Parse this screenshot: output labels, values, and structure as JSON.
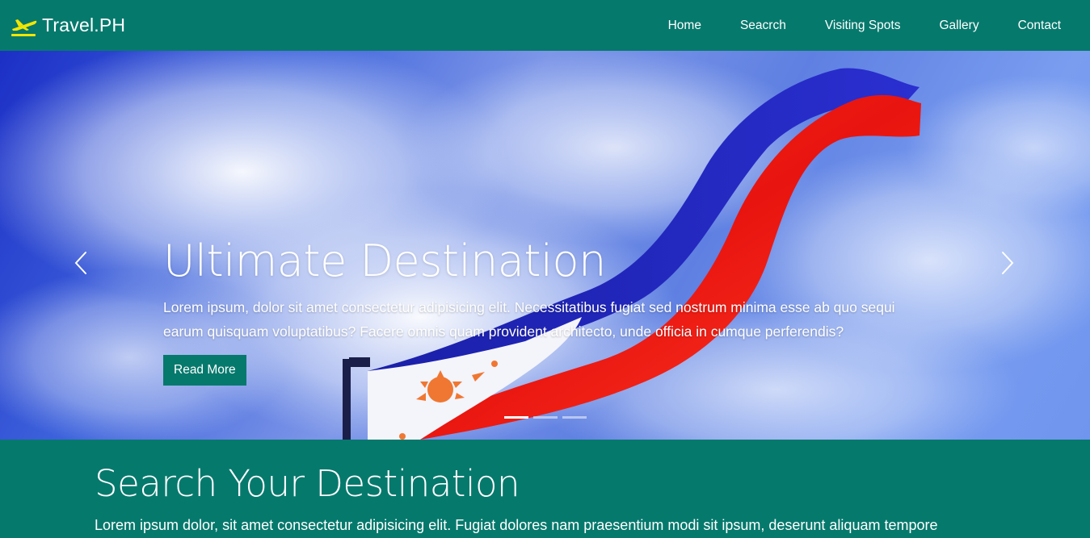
{
  "brand": {
    "name": "Travel.PH",
    "icon": "airplane-icon",
    "icon_color": "#f2e600"
  },
  "colors": {
    "primary": "#06796d",
    "text": "#ffffff"
  },
  "nav": {
    "items": [
      {
        "label": "Home"
      },
      {
        "label": "Seacrch"
      },
      {
        "label": "Visiting Spots"
      },
      {
        "label": "Gallery"
      },
      {
        "label": "Contact"
      }
    ]
  },
  "carousel": {
    "title": "Ultimate Destination",
    "text": "Lorem ipsum, dolor sit amet consectetur adipisicing elit. Necessitatibus fugiat sed nostrum minima esse ab quo sequi earum quisquam voluptatibus? Facere omnis quam provident architecto, unde officia in cumque perferendis?",
    "button_label": "Read More",
    "slide_count": 3,
    "active_slide": 1,
    "prev_icon": "chevron-left-icon",
    "next_icon": "chevron-right-icon"
  },
  "search_section": {
    "title": "Search Your Destination",
    "text": "Lorem ipsum dolor, sit amet consectetur adipisicing elit. Fugiat dolores nam praesentium modi sit ipsum, deserunt aliquam tempore"
  }
}
